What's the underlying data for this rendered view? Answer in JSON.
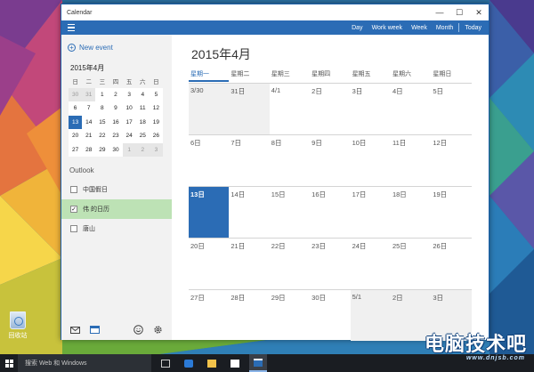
{
  "window": {
    "title": "Calendar",
    "controls": [
      "—",
      "☐",
      "✕"
    ]
  },
  "toolbar": {
    "views": [
      "Day",
      "Work week",
      "Week",
      "Month"
    ],
    "today": "Today"
  },
  "sidebar": {
    "new_event": "New event",
    "mini_title": "2015年4月",
    "mini_weekdays": [
      "日",
      "二",
      "三",
      "四",
      "五",
      "六",
      "日"
    ],
    "mini_weeks": [
      [
        "30",
        "31",
        "1",
        "2",
        "3",
        "4",
        "5"
      ],
      [
        "6",
        "7",
        "8",
        "9",
        "10",
        "11",
        "12"
      ],
      [
        "13",
        "14",
        "15",
        "16",
        "17",
        "18",
        "19"
      ],
      [
        "20",
        "21",
        "22",
        "23",
        "24",
        "25",
        "26"
      ],
      [
        "27",
        "28",
        "29",
        "30",
        "1",
        "2",
        "3"
      ]
    ],
    "account": "Outlook",
    "calendars": [
      {
        "label": "中国假日",
        "checked": false
      },
      {
        "label": "伟 的日历",
        "checked": true
      },
      {
        "label": "唐山",
        "checked": false
      }
    ]
  },
  "main": {
    "month_title": "2015年4月",
    "weekdays": [
      "星期一",
      "星期二",
      "星期三",
      "星期四",
      "星期五",
      "星期六",
      "星期日"
    ],
    "weeks": [
      [
        "3/30",
        "31日",
        "4/1",
        "2日",
        "3日",
        "4日",
        "5日"
      ],
      [
        "6日",
        "7日",
        "8日",
        "9日",
        "10日",
        "11日",
        "12日"
      ],
      [
        "13日",
        "14日",
        "15日",
        "16日",
        "17日",
        "18日",
        "19日"
      ],
      [
        "20日",
        "21日",
        "22日",
        "23日",
        "24日",
        "25日",
        "26日"
      ],
      [
        "27日",
        "28日",
        "29日",
        "30日",
        "5/1",
        "2日",
        "3日"
      ]
    ]
  },
  "desktop": {
    "recycle_bin": "回收站"
  },
  "taskbar": {
    "search_placeholder": "搜索 Web 和 Windows"
  },
  "watermark": {
    "main": "电脑技术吧",
    "sub": "www.dnjsb.com"
  },
  "colors": {
    "accent": "#2b6cb5",
    "selected_calendar": "#bde2b5",
    "taskbar": "#1a1d22"
  }
}
